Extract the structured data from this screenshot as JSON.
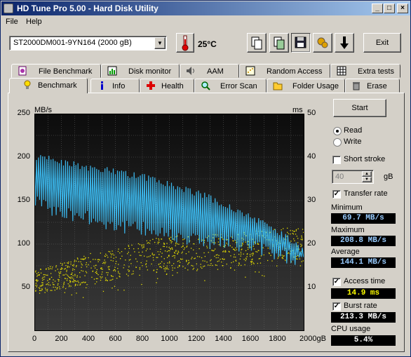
{
  "window": {
    "title": "HD Tune Pro 5.00 - Hard Disk Utility"
  },
  "menu": [
    "File",
    "Help"
  ],
  "toolbar": {
    "drive": "ST2000DM001-9YN164 (2000 gB)",
    "temperature": "25°C",
    "exit_label": "Exit"
  },
  "tabs_row1": [
    "File Benchmark",
    "Disk monitor",
    "AAM",
    "Random Access",
    "Extra tests"
  ],
  "tabs_row2": [
    "Benchmark",
    "Info",
    "Health",
    "Error Scan",
    "Folder Usage",
    "Erase"
  ],
  "side": {
    "start_label": "Start",
    "read_label": "Read",
    "write_label": "Write",
    "short_stroke_label": "Short stroke",
    "short_stroke_value": "40",
    "short_stroke_unit": "gB",
    "transfer_rate_label": "Transfer rate",
    "minimum_label": "Minimum",
    "minimum_value": "69.7 MB/s",
    "maximum_label": "Maximum",
    "maximum_value": "208.8 MB/s",
    "average_label": "Average",
    "average_value": "144.1 MB/s",
    "access_time_label": "Access time",
    "access_time_value": "14.9 ms",
    "burst_rate_label": "Burst rate",
    "burst_rate_value": "213.3 MB/s",
    "cpu_label": "CPU usage",
    "cpu_value": "5.4%",
    "read_selected": true,
    "short_stroke_checked": false,
    "transfer_rate_checked": true,
    "access_time_checked": true,
    "burst_rate_checked": true
  },
  "colors": {
    "transfer_line": "#3ab4e8",
    "access_dots": "#e8e000",
    "plot_bg": "#222222",
    "grid": "#666666"
  },
  "chart_data": {
    "type": "line",
    "left_axis_label": "MB/s",
    "right_axis_label": "ms",
    "left_ylim": [
      0,
      250
    ],
    "right_ylim": [
      0,
      50
    ],
    "xlim": [
      0,
      2000
    ],
    "x_ticks": [
      "0",
      "200",
      "400",
      "600",
      "800",
      "1000",
      "1200",
      "1400",
      "1600",
      "1800",
      "2000gB"
    ],
    "left_ticks": [
      "250",
      "200",
      "150",
      "100",
      "50"
    ],
    "right_ticks": [
      "50",
      "40",
      "30",
      "20",
      "10"
    ],
    "grid": true,
    "transfer_rate_upper": [
      [
        0,
        205
      ],
      [
        100,
        202
      ],
      [
        200,
        198
      ],
      [
        300,
        195
      ],
      [
        400,
        192
      ],
      [
        500,
        190
      ],
      [
        600,
        187
      ],
      [
        700,
        184
      ],
      [
        800,
        181
      ],
      [
        900,
        178
      ],
      [
        1000,
        173
      ],
      [
        1100,
        168
      ],
      [
        1200,
        163
      ],
      [
        1300,
        157
      ],
      [
        1400,
        150
      ],
      [
        1500,
        144
      ],
      [
        1600,
        136
      ],
      [
        1700,
        127
      ],
      [
        1800,
        118
      ],
      [
        1900,
        108
      ],
      [
        2000,
        95
      ]
    ],
    "transfer_rate_lower": [
      [
        0,
        140
      ],
      [
        100,
        132
      ],
      [
        200,
        128
      ],
      [
        300,
        125
      ],
      [
        400,
        120
      ],
      [
        500,
        117
      ],
      [
        600,
        113
      ],
      [
        700,
        110
      ],
      [
        800,
        108
      ],
      [
        900,
        105
      ],
      [
        1000,
        103
      ],
      [
        1100,
        100
      ],
      [
        1200,
        97
      ],
      [
        1300,
        94
      ],
      [
        1400,
        92
      ],
      [
        1500,
        90
      ],
      [
        1600,
        88
      ],
      [
        1700,
        85
      ],
      [
        1800,
        80
      ],
      [
        1900,
        76
      ],
      [
        2000,
        72
      ]
    ],
    "access_time_band": [
      [
        0,
        8,
        14
      ],
      [
        200,
        10,
        16
      ],
      [
        400,
        11,
        18
      ],
      [
        600,
        12,
        19
      ],
      [
        800,
        13,
        21
      ],
      [
        1000,
        14,
        22
      ],
      [
        1200,
        14,
        22
      ],
      [
        1400,
        15,
        23
      ],
      [
        1600,
        15,
        23
      ],
      [
        1800,
        16,
        24
      ],
      [
        2000,
        16,
        24
      ]
    ]
  }
}
